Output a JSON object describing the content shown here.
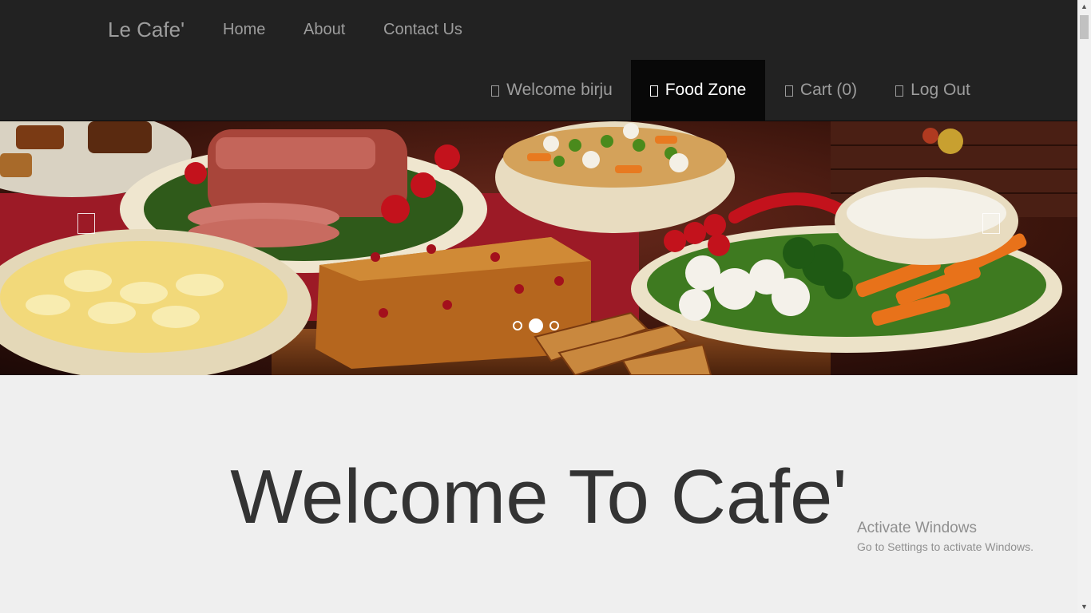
{
  "navbar": {
    "brand": "Le Cafe'",
    "links": [
      {
        "label": "Home"
      },
      {
        "label": "About"
      },
      {
        "label": "Contact Us"
      }
    ],
    "right_items": [
      {
        "label": "Welcome birju",
        "icon": "user-icon",
        "active": false
      },
      {
        "label": "Food Zone",
        "icon": "cutlery-icon",
        "active": true
      },
      {
        "label": "Cart (0)",
        "icon": "cart-icon",
        "active": false
      },
      {
        "label": "Log Out",
        "icon": "logout-icon",
        "active": false
      }
    ],
    "colors": {
      "bg": "#222222",
      "text": "#9d9d9d",
      "active_bg": "#080808"
    }
  },
  "carousel": {
    "image_description_icon": "food-banner-image",
    "active_slide": 2,
    "slide_count": 3,
    "prev_icon": "chevron-left-icon",
    "next_icon": "chevron-right-icon"
  },
  "main": {
    "headline": "Welcome To Cafe'"
  },
  "os_overlay": {
    "title": "Activate Windows",
    "subtitle": "Go to Settings to activate Windows."
  }
}
